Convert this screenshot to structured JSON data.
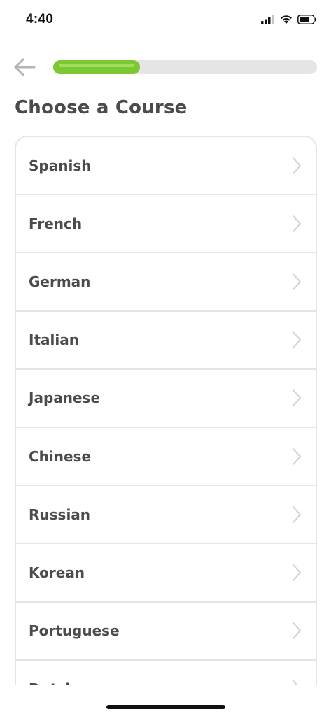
{
  "status_bar": {
    "time": "4:40",
    "icons": [
      "signal-icon",
      "wifi-icon",
      "battery-icon"
    ]
  },
  "header": {
    "back_icon": "arrow-left-icon",
    "progress": 0.33,
    "progress_color": "#7dc733",
    "track_color": "#e5e5e5"
  },
  "page_title": "Choose a Course",
  "courses": [
    {
      "label": "Spanish"
    },
    {
      "label": "French"
    },
    {
      "label": "German"
    },
    {
      "label": "Italian"
    },
    {
      "label": "Japanese"
    },
    {
      "label": "Chinese"
    },
    {
      "label": "Russian"
    },
    {
      "label": "Korean"
    },
    {
      "label": "Portuguese"
    },
    {
      "label": "Dutch"
    }
  ],
  "colors": {
    "text": "#4b4b4b",
    "border": "#e5e5e5",
    "chevron": "#d0d0d0"
  }
}
